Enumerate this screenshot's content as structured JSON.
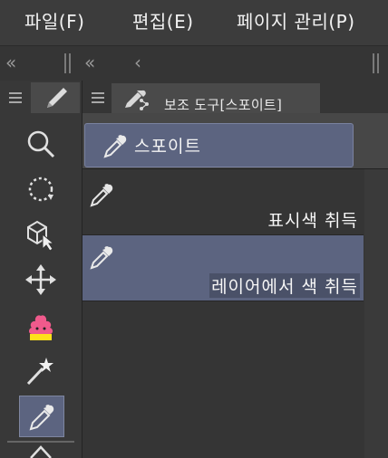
{
  "menu": {
    "items": [
      "파일(F)",
      "편집(E)",
      "페이지 관리(P)"
    ]
  },
  "toolbar": {
    "tools": [
      {
        "name": "zoom",
        "icon": "magnifier-icon"
      },
      {
        "name": "rotate",
        "icon": "rotate-icon"
      },
      {
        "name": "object",
        "icon": "object-select-icon"
      },
      {
        "name": "move",
        "icon": "move-icon"
      },
      {
        "name": "decorate",
        "icon": "pudding-icon"
      },
      {
        "name": "auto-select",
        "icon": "magic-wand-icon"
      },
      {
        "name": "eyedropper",
        "icon": "eyedropper-icon",
        "selected": true
      }
    ]
  },
  "panel": {
    "title": "보조 도구[스포이트]",
    "group_label": "스포이트",
    "subtools": [
      {
        "label": "표시색 취득",
        "selected": false
      },
      {
        "label": "레이어에서 색 취득",
        "selected": true
      }
    ]
  },
  "colors": {
    "selection": "#5c6480",
    "background": "#323232"
  }
}
